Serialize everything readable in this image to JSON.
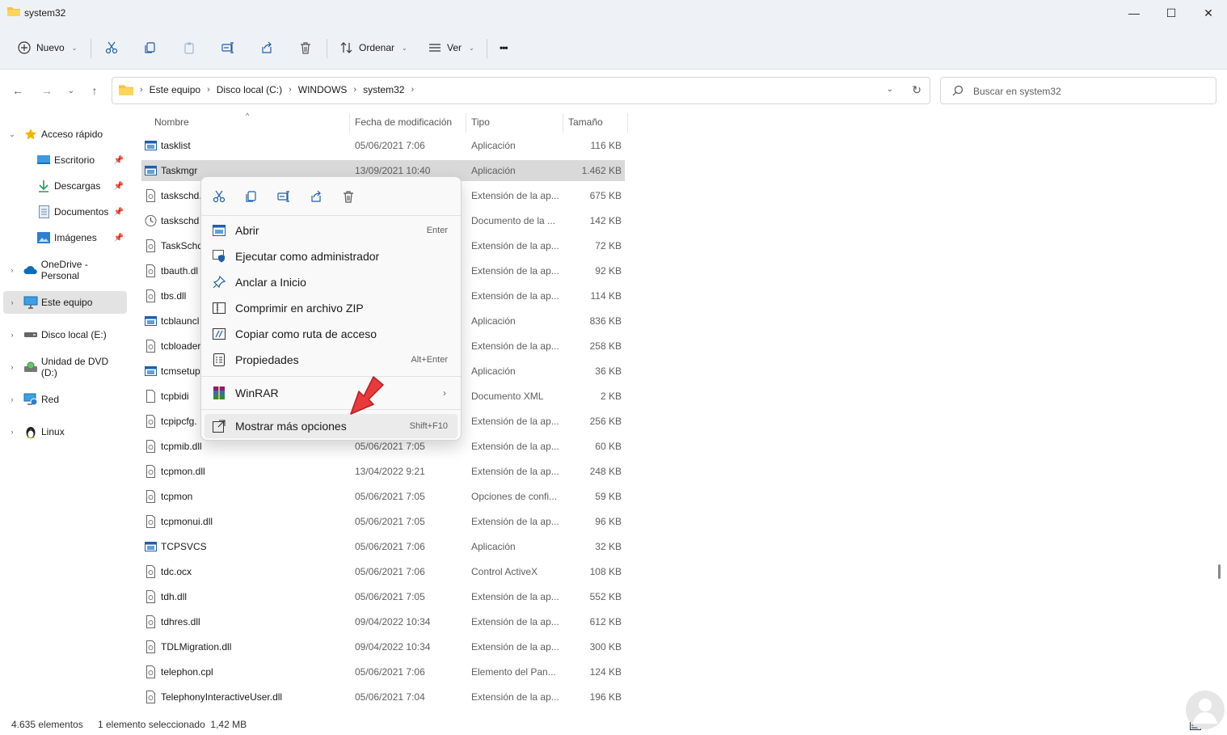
{
  "window": {
    "title": "system32",
    "minimize": "—",
    "maximize": "☐",
    "close": "✕"
  },
  "toolbar": {
    "new_label": "Nuevo",
    "sort_label": "Ordenar",
    "view_label": "Ver",
    "more_label": "•••"
  },
  "nav": {
    "crumbs": [
      "Este equipo",
      "Disco local (C:)",
      "WINDOWS",
      "system32"
    ],
    "search_placeholder": "Buscar en system32"
  },
  "sidebar": {
    "items": [
      {
        "label": "Acceso rápido"
      },
      {
        "label": "Escritorio"
      },
      {
        "label": "Descargas"
      },
      {
        "label": "Documentos"
      },
      {
        "label": "Imágenes"
      },
      {
        "label": "OneDrive - Personal"
      },
      {
        "label": "Este equipo"
      },
      {
        "label": "Disco local (E:)"
      },
      {
        "label": "Unidad de DVD (D:)"
      },
      {
        "label": "Red"
      },
      {
        "label": "Linux"
      }
    ]
  },
  "columns": {
    "name": "Nombre",
    "date": "Fecha de modificación",
    "type": "Tipo",
    "size": "Tamaño"
  },
  "files": [
    {
      "name": "tasklist",
      "date": "05/06/2021 7:06",
      "type": "Aplicación",
      "size": "116 KB"
    },
    {
      "name": "Taskmgr",
      "date": "13/09/2021 10:40",
      "type": "Aplicación",
      "size": "1.462 KB"
    },
    {
      "name": "taskschd.",
      "date": "",
      "type": "Extensión de la ap...",
      "size": "675 KB"
    },
    {
      "name": "taskschd",
      "date": "",
      "type": "Documento de la ...",
      "size": "142 KB"
    },
    {
      "name": "TaskSchd",
      "date": "",
      "type": "Extensión de la ap...",
      "size": "72 KB"
    },
    {
      "name": "tbauth.dl",
      "date": "",
      "type": "Extensión de la ap...",
      "size": "92 KB"
    },
    {
      "name": "tbs.dll",
      "date": "",
      "type": "Extensión de la ap...",
      "size": "114 KB"
    },
    {
      "name": "tcblauncl",
      "date": "",
      "type": "Aplicación",
      "size": "836 KB"
    },
    {
      "name": "tcbloader",
      "date": "",
      "type": "Extensión de la ap...",
      "size": "258 KB"
    },
    {
      "name": "tcmsetup",
      "date": "",
      "type": "Aplicación",
      "size": "36 KB"
    },
    {
      "name": "tcpbidi",
      "date": "",
      "type": "Documento XML",
      "size": "2 KB"
    },
    {
      "name": "tcpipcfg.",
      "date": "",
      "type": "Extensión de la ap...",
      "size": "256 KB"
    },
    {
      "name": "tcpmib.dll",
      "date": "05/06/2021 7:05",
      "type": "Extensión de la ap...",
      "size": "60 KB"
    },
    {
      "name": "tcpmon.dll",
      "date": "13/04/2022 9:21",
      "type": "Extensión de la ap...",
      "size": "248 KB"
    },
    {
      "name": "tcpmon",
      "date": "05/06/2021 7:05",
      "type": "Opciones de confi...",
      "size": "59 KB"
    },
    {
      "name": "tcpmonui.dll",
      "date": "05/06/2021 7:05",
      "type": "Extensión de la ap...",
      "size": "96 KB"
    },
    {
      "name": "TCPSVCS",
      "date": "05/06/2021 7:06",
      "type": "Aplicación",
      "size": "32 KB"
    },
    {
      "name": "tdc.ocx",
      "date": "05/06/2021 7:06",
      "type": "Control ActiveX",
      "size": "108 KB"
    },
    {
      "name": "tdh.dll",
      "date": "05/06/2021 7:05",
      "type": "Extensión de la ap...",
      "size": "552 KB"
    },
    {
      "name": "tdhres.dll",
      "date": "09/04/2022 10:34",
      "type": "Extensión de la ap...",
      "size": "612 KB"
    },
    {
      "name": "TDLMigration.dll",
      "date": "09/04/2022 10:34",
      "type": "Extensión de la ap...",
      "size": "300 KB"
    },
    {
      "name": "telephon.cpl",
      "date": "05/06/2021 7:06",
      "type": "Elemento del Pan...",
      "size": "124 KB"
    },
    {
      "name": "TelephonyInteractiveUser.dll",
      "date": "05/06/2021 7:04",
      "type": "Extensión de la ap...",
      "size": "196 KB"
    }
  ],
  "context_menu": {
    "items": [
      {
        "label": "Abrir",
        "shortcut": "Enter"
      },
      {
        "label": "Ejecutar como administrador",
        "shortcut": ""
      },
      {
        "label": "Anclar a Inicio",
        "shortcut": ""
      },
      {
        "label": "Comprimir en archivo ZIP",
        "shortcut": ""
      },
      {
        "label": "Copiar como ruta de acceso",
        "shortcut": ""
      },
      {
        "label": "Propiedades",
        "shortcut": "Alt+Enter"
      },
      {
        "label": "WinRAR",
        "shortcut": "›"
      },
      {
        "label": "Mostrar más opciones",
        "shortcut": "Shift+F10"
      }
    ]
  },
  "status": {
    "count": "4.635 elementos",
    "selection": "1 elemento seleccionado  1,42 MB"
  },
  "colors": {
    "accent": "#0067c0",
    "selection": "#d9d9d9",
    "arrow": "#e8393b"
  }
}
